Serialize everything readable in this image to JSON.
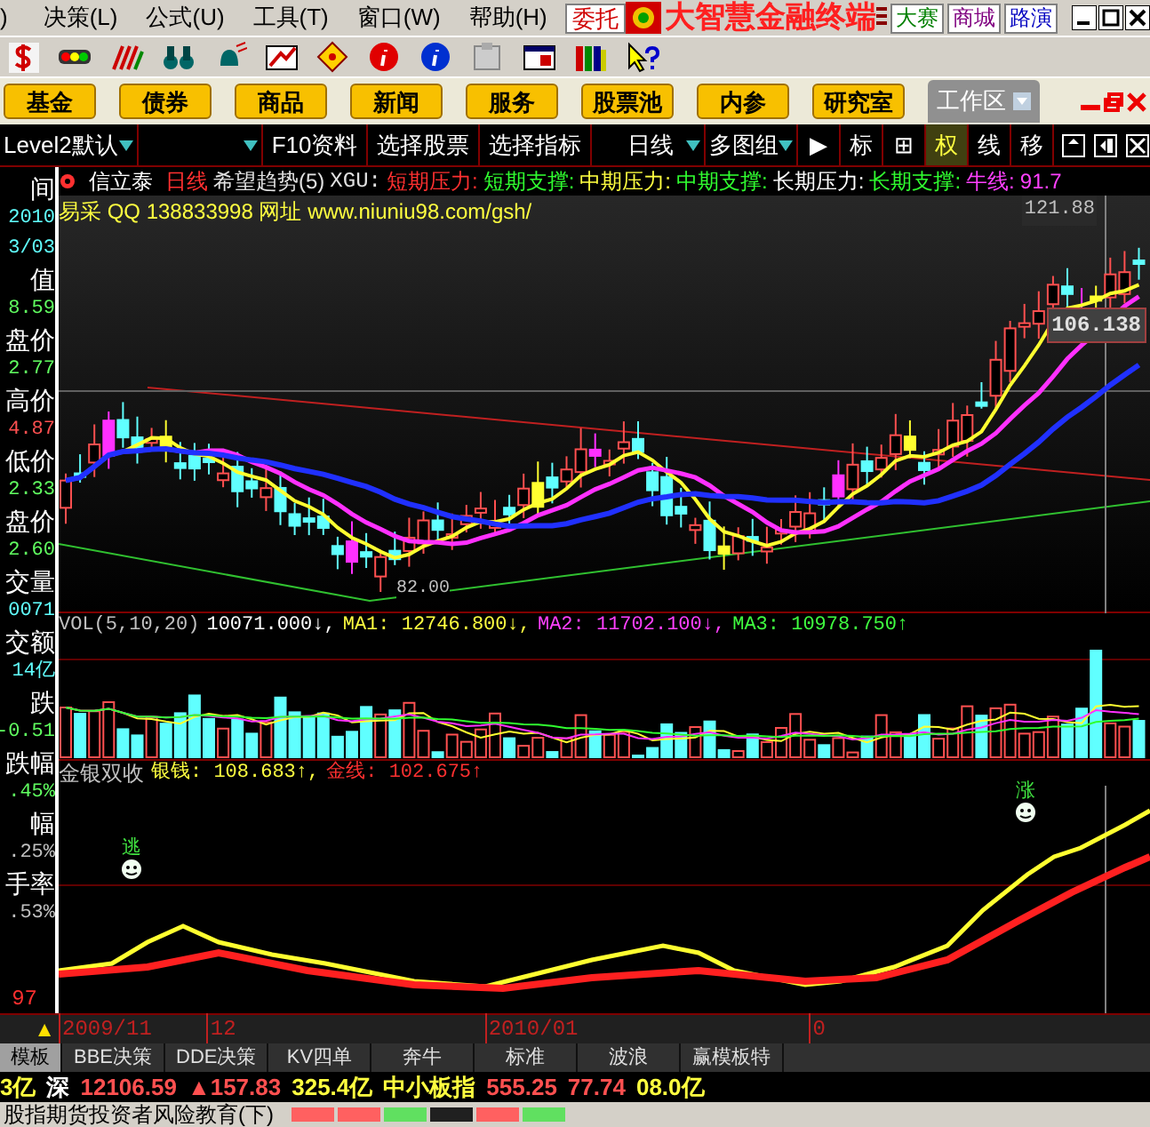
{
  "menu": {
    "items": [
      ")",
      "决策(L)",
      "公式(U)",
      "工具(T)",
      "窗口(W)",
      "帮助(H)"
    ],
    "entrust_button": "委托",
    "app_title": "大智慧金融终端",
    "buttons": [
      {
        "label": "大赛",
        "color": "#008000"
      },
      {
        "label": "商城",
        "color": "#800080"
      },
      {
        "label": "路演",
        "color": "#0000c0"
      }
    ]
  },
  "quick_buttons": [
    "基金",
    "债券",
    "商品",
    "新闻",
    "服务",
    "股票池",
    "内参",
    "研究室"
  ],
  "workspace_tab": "工作区",
  "toolbar": {
    "dropdowns": [
      {
        "label": "Level2默认"
      }
    ],
    "buttons": [
      {
        "label": "F10资料",
        "selected": false
      },
      {
        "label": "选择股票",
        "selected": false
      },
      {
        "label": "选择指标",
        "selected": false
      }
    ],
    "period_dropdowns": [
      {
        "label": "日线"
      },
      {
        "label": "多图组"
      }
    ],
    "toggles": [
      {
        "label": "▶",
        "selected": false
      },
      {
        "label": "标",
        "selected": false
      },
      {
        "label": "⊞",
        "selected": false
      },
      {
        "label": "权",
        "selected": true
      },
      {
        "label": "线",
        "selected": false
      },
      {
        "label": "移",
        "selected": false
      }
    ]
  },
  "chart_header": {
    "stock": "信立泰",
    "period": "日线",
    "indicator": "希望趋势(5)",
    "formula": "XGU:",
    "legend": [
      {
        "label": "短期压力:",
        "kind": "shortterm"
      },
      {
        "label": "短期支撑:",
        "kind": "support"
      },
      {
        "label": "中期压力:",
        "kind": "midterm"
      },
      {
        "label": "中期支撑:",
        "kind": "support"
      },
      {
        "label": "长期压力:",
        "kind": "longterm"
      },
      {
        "label": "长期支撑:",
        "kind": "support"
      },
      {
        "label": "牛线:",
        "kind": "bull"
      },
      {
        "label": "91.7",
        "kind": "bull"
      }
    ]
  },
  "chart_note": "易采 QQ 138833998 网址 www.niuniu98.com/gsh/",
  "price_labels": {
    "high": "121.88",
    "cursor": "106.138",
    "low": "82.00"
  },
  "info_panel": [
    {
      "label": "间",
      "values": [
        "2010",
        "3/03"
      ],
      "color": "#60ffff"
    },
    {
      "label": "值",
      "values": [
        "8.59"
      ],
      "color": "#60ff60"
    },
    {
      "label": "盘价",
      "values": [
        "2.77"
      ],
      "color": "#60ff60"
    },
    {
      "label": "高价",
      "values": [
        "4.87"
      ],
      "color": "#ff5050"
    },
    {
      "label": "低价",
      "values": [
        "2.33"
      ],
      "color": "#60ff60"
    },
    {
      "label": "盘价",
      "values": [
        "2.60"
      ],
      "color": "#60ff60"
    },
    {
      "label": "交量",
      "values": [
        "0071"
      ],
      "color": "#60ffff"
    },
    {
      "label": "交额",
      "values": [
        "14亿"
      ],
      "color": "#60ffff"
    },
    {
      "label": "跌",
      "values": [
        "-0.51"
      ],
      "color": "#60ff60"
    },
    {
      "label": "跌幅",
      "values": [
        ".45%"
      ],
      "color": "#60ff60"
    },
    {
      "label": "幅",
      "values": [
        ".25%"
      ],
      "color": "#c0c0c0"
    },
    {
      "label": "手率",
      "values": [
        ".53%"
      ],
      "color": "#c0c0c0"
    }
  ],
  "volume": {
    "title": "VOL(5,10,20)",
    "values": [
      {
        "label": "10071.000↓,",
        "color": "#ffffff"
      },
      {
        "label": "MA1: 12746.800↓,",
        "color": "#ffff40"
      },
      {
        "label": "MA2: 11702.100↓,",
        "color": "#ff40ff"
      },
      {
        "label": "MA3: 10978.750↑",
        "color": "#40ff40"
      }
    ]
  },
  "indicator": {
    "title": "金银双收",
    "values": [
      {
        "label": "银钱: 108.683↑,",
        "color": "#ffff40"
      },
      {
        "label": "金线: 102.675↑",
        "color": "#ff3030"
      }
    ],
    "signals": [
      {
        "label": "逃"
      },
      {
        "label": "涨"
      }
    ],
    "axis_label": "97"
  },
  "date_axis": {
    "marker": "▲",
    "dates": [
      "2009/11",
      "12",
      "2010/01",
      "0"
    ]
  },
  "tabs": [
    {
      "label": "模板",
      "selected": true
    },
    {
      "label": "BBE决策",
      "selected": false
    },
    {
      "label": "DDE决策",
      "selected": false
    },
    {
      "label": "KV四单",
      "selected": false
    },
    {
      "label": "奔牛",
      "selected": false
    },
    {
      "label": "标准",
      "selected": false
    },
    {
      "label": "波浪",
      "selected": false
    },
    {
      "label": "赢模板特",
      "selected": false
    }
  ],
  "ticker": [
    {
      "label": "3亿",
      "kind": "amount"
    },
    {
      "label": "深",
      "kind": "market"
    },
    {
      "label": "12106.59",
      "kind": "index"
    },
    {
      "label": "▲157.83",
      "kind": "change"
    },
    {
      "label": "325.4亿",
      "kind": "amount"
    },
    {
      "label": "中小板指",
      "kind": "name"
    },
    {
      "label": "555.25",
      "kind": "index"
    },
    {
      "label": "77.74",
      "kind": "change"
    },
    {
      "label": "08.0亿",
      "kind": "amount"
    }
  ],
  "news": "股指期货投资者风险教育(下)"
}
